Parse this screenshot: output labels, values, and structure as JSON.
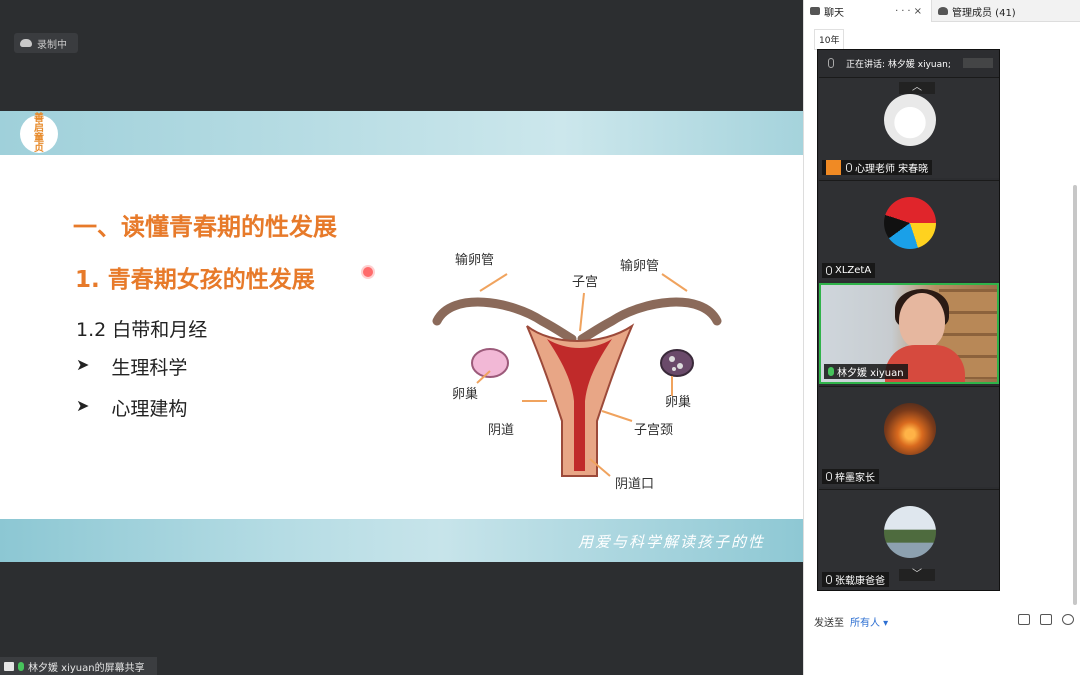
{
  "recording": {
    "label": "录制中"
  },
  "slide": {
    "logo": [
      "善",
      "启",
      "童",
      "贞"
    ],
    "heading1": "一、读懂青春期的性发展",
    "heading2": "1. 青春期女孩的性发展",
    "subheading": "1.2  白带和月经",
    "bullets": [
      {
        "marker": "➤",
        "text": "生理科学"
      },
      {
        "marker": "➤",
        "text": "心理建构"
      }
    ],
    "slogan": "用爱与科学解读孩子的性",
    "diagram_labels": {
      "tube_left": "输卵管",
      "tube_right": "输卵管",
      "uterus": "子宫",
      "ovary_left": "卵巢",
      "ovary_right": "卵巢",
      "vagina": "阴道",
      "cervix": "子宫颈",
      "vaginal_opening": "阴道口"
    }
  },
  "share_bar": {
    "label": "林夕媛 xiyuan的屏幕共享"
  },
  "panel": {
    "tabs": [
      {
        "label": "聊天",
        "icon": "chat-icon"
      },
      {
        "label": "管理成员 (41)",
        "icon": "members-icon"
      }
    ],
    "chat_first_message": "10年",
    "send_to_label": "发送至",
    "send_to_value": "所有人 ▾"
  },
  "video_panel": {
    "speaking": "正在讲话: 林夕媛 xiyuan;",
    "participants": [
      {
        "name": "心理老师 宋春晓",
        "host": true,
        "mic": "muted"
      },
      {
        "name": "XLZetA",
        "host": false,
        "mic": "muted"
      },
      {
        "name": "林夕媛 xiyuan",
        "host": false,
        "mic": "on",
        "active": true
      },
      {
        "name": "梓墨家长",
        "host": false,
        "mic": "muted"
      },
      {
        "name": "张载康爸爸",
        "host": false,
        "mic": "muted"
      }
    ],
    "scroll_up": "︿",
    "scroll_down": "﹀"
  },
  "colors": {
    "accent_orange": "#e77a2a",
    "active_green": "#2fb34a",
    "link_blue": "#2d6fd2"
  }
}
